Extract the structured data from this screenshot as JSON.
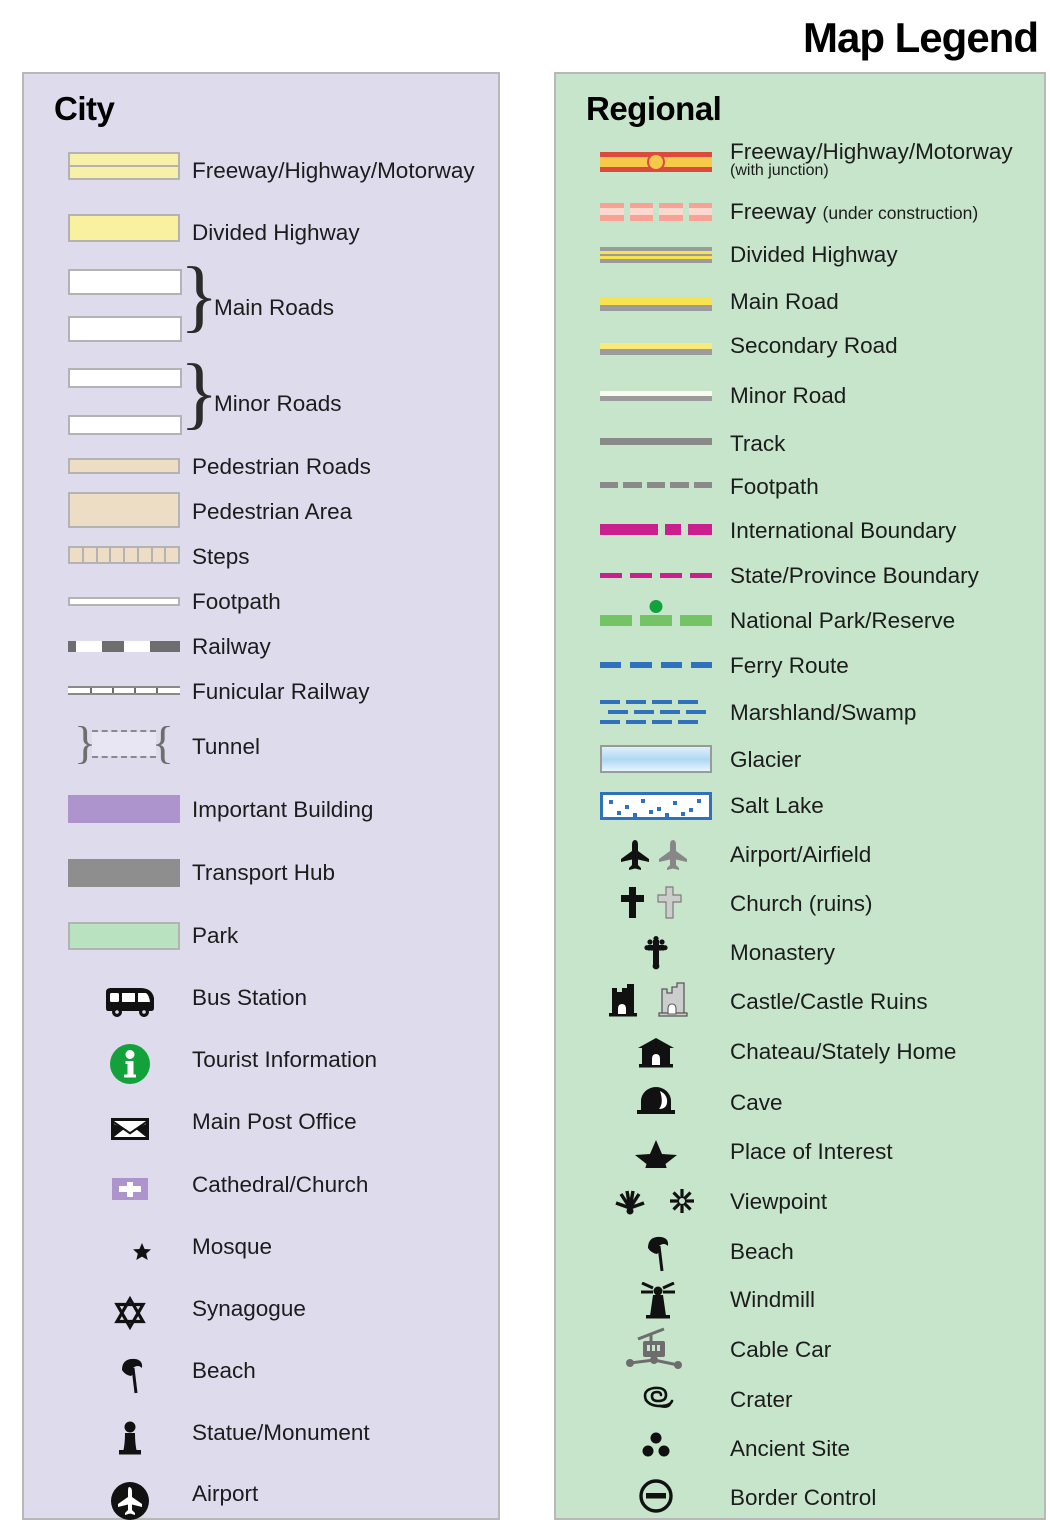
{
  "title": "Map Legend",
  "city": {
    "heading": "City",
    "items": [
      {
        "label": "Freeway/Highway/Motorway",
        "symbol": "freeway-band"
      },
      {
        "label": "Divided Highway",
        "symbol": "divided-highway-band"
      },
      {
        "label": "Main Roads",
        "symbol": "main-roads-pair-braced"
      },
      {
        "label": "Minor Roads",
        "symbol": "minor-roads-pair-braced"
      },
      {
        "label": "Pedestrian Roads",
        "symbol": "pedestrian-road-band"
      },
      {
        "label": "Pedestrian Area",
        "symbol": "pedestrian-area-block"
      },
      {
        "label": "Steps",
        "symbol": "steps-hatched-band"
      },
      {
        "label": "Footpath",
        "symbol": "footpath-thin-line"
      },
      {
        "label": "Railway",
        "symbol": "railway-dashed-line"
      },
      {
        "label": "Funicular Railway",
        "symbol": "funicular-ticked-line"
      },
      {
        "label": "Tunnel",
        "symbol": "tunnel-brackets"
      },
      {
        "label": "Important Building",
        "symbol": "important-building-swatch"
      },
      {
        "label": "Transport Hub",
        "symbol": "transport-hub-swatch"
      },
      {
        "label": "Park",
        "symbol": "park-swatch"
      },
      {
        "label": "Bus Station",
        "symbol": "bus-icon"
      },
      {
        "label": "Tourist Information",
        "symbol": "information-icon"
      },
      {
        "label": "Main Post Office",
        "symbol": "envelope-icon"
      },
      {
        "label": "Cathedral/Church",
        "symbol": "cathedral-icon"
      },
      {
        "label": "Mosque",
        "symbol": "mosque-icon"
      },
      {
        "label": "Synagogue",
        "symbol": "synagogue-icon"
      },
      {
        "label": "Beach",
        "symbol": "beach-umbrella-icon"
      },
      {
        "label": "Statue/Monument",
        "symbol": "statue-icon"
      },
      {
        "label": "Airport",
        "symbol": "airport-circle-icon"
      }
    ]
  },
  "regional": {
    "heading": "Regional",
    "items": [
      {
        "label": "Freeway/Highway/Motorway",
        "sub": "(with junction)",
        "symbol": "freeway-junction-line"
      },
      {
        "label": "Freeway",
        "inline": "(under construction)",
        "symbol": "freeway-under-construction-line"
      },
      {
        "label": "Divided Highway",
        "symbol": "divided-highway-line"
      },
      {
        "label": "Main Road",
        "symbol": "main-road-line"
      },
      {
        "label": "Secondary Road",
        "symbol": "secondary-road-line"
      },
      {
        "label": "Minor Road",
        "symbol": "minor-road-line"
      },
      {
        "label": "Track",
        "symbol": "track-line"
      },
      {
        "label": "Footpath",
        "symbol": "footpath-dashed-line"
      },
      {
        "label": "International Boundary",
        "symbol": "international-boundary-line"
      },
      {
        "label": "State/Province Boundary",
        "symbol": "state-boundary-line"
      },
      {
        "label": "National Park/Reserve",
        "symbol": "national-park-line"
      },
      {
        "label": "Ferry Route",
        "symbol": "ferry-route-line"
      },
      {
        "label": "Marshland/Swamp",
        "symbol": "marshland-pattern"
      },
      {
        "label": "Glacier",
        "symbol": "glacier-swatch"
      },
      {
        "label": "Salt Lake",
        "symbol": "salt-lake-swatch"
      },
      {
        "label": "Airport/Airfield",
        "symbol": "airplane-icons"
      },
      {
        "label": "Church (ruins)",
        "symbol": "cross-icons"
      },
      {
        "label": "Monastery",
        "symbol": "monastery-cross-icon"
      },
      {
        "label": "Castle/Castle Ruins",
        "symbol": "castle-icons"
      },
      {
        "label": "Chateau/Stately Home",
        "symbol": "chateau-icon"
      },
      {
        "label": "Cave",
        "symbol": "cave-icon"
      },
      {
        "label": "Place of Interest",
        "symbol": "star-icon"
      },
      {
        "label": "Viewpoint",
        "symbol": "viewpoint-icons"
      },
      {
        "label": "Beach",
        "symbol": "beach-umbrella-icon"
      },
      {
        "label": "Windmill",
        "symbol": "windmill-icon"
      },
      {
        "label": "Cable Car",
        "symbol": "cable-car-icon"
      },
      {
        "label": "Crater",
        "symbol": "crater-icon"
      },
      {
        "label": "Ancient Site",
        "symbol": "ancient-site-icon"
      },
      {
        "label": "Border Control",
        "symbol": "border-control-icon"
      }
    ]
  },
  "colors": {
    "city_panel_bg": "#dedcec",
    "regional_panel_bg": "#c6e5cb",
    "panel_border": "#b8b8b8",
    "highway_yellow": "#f9f0a0",
    "pedestrian_tan": "#ecddc4",
    "important_building_purple": "#ad94cd",
    "transport_hub_gray": "#8e8e8e",
    "park_green": "#b8e2c0",
    "info_green": "#13a13b",
    "freeway_red": "#dd4a3c",
    "junction_orange": "#f6c94a",
    "under_construction_pink": "#f7a295",
    "boundary_magenta": "#cc1f8e",
    "park_line_green": "#74c364",
    "ferry_blue": "#2f71bd",
    "glacier_blue": "#aed8f2"
  }
}
